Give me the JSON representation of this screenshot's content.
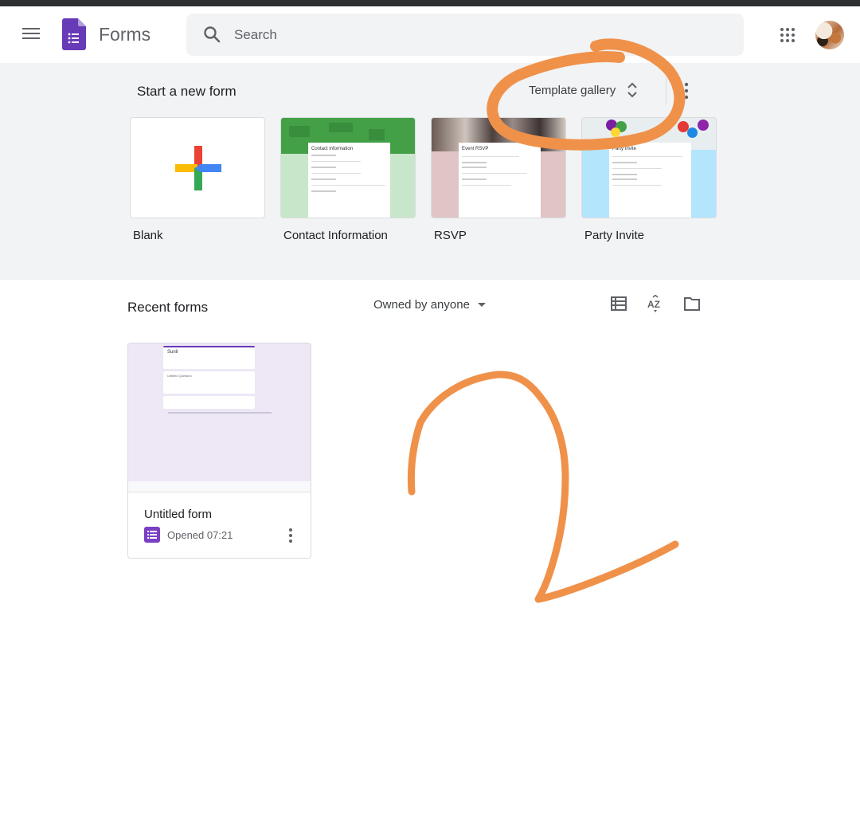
{
  "header": {
    "app_name": "Forms",
    "search_placeholder": "Search",
    "icons": {
      "menu": "hamburger-menu-icon",
      "logo": "google-forms-logo",
      "search": "search-icon",
      "apps": "apps-grid-icon",
      "account": "account-avatar"
    }
  },
  "new_form_section": {
    "title": "Start a new form",
    "template_gallery_label": "Template gallery",
    "template_gallery_icon": "unfold-more-icon",
    "more_icon": "more-vert-icon",
    "templates": [
      {
        "label": "Blank",
        "thumb_title": ""
      },
      {
        "label": "Contact Information",
        "thumb_title": "Contact information"
      },
      {
        "label": "RSVP",
        "thumb_title": "Event RSVP"
      },
      {
        "label": "Party Invite",
        "thumb_title": "Party Invite"
      }
    ]
  },
  "recent_section": {
    "title": "Recent forms",
    "owner_filter": "Owned by anyone",
    "view_icons": [
      "list-view-icon",
      "sort-az-icon",
      "folder-icon"
    ],
    "forms": [
      {
        "title": "Untitled form",
        "opened": "Opened 07:21",
        "preview": {
          "heading": "Sunil",
          "question": "Untitled Question"
        }
      }
    ]
  },
  "annotations": {
    "color": "#f0914a",
    "items": [
      "circle-around-template-gallery",
      "handwritten-number-2"
    ]
  }
}
